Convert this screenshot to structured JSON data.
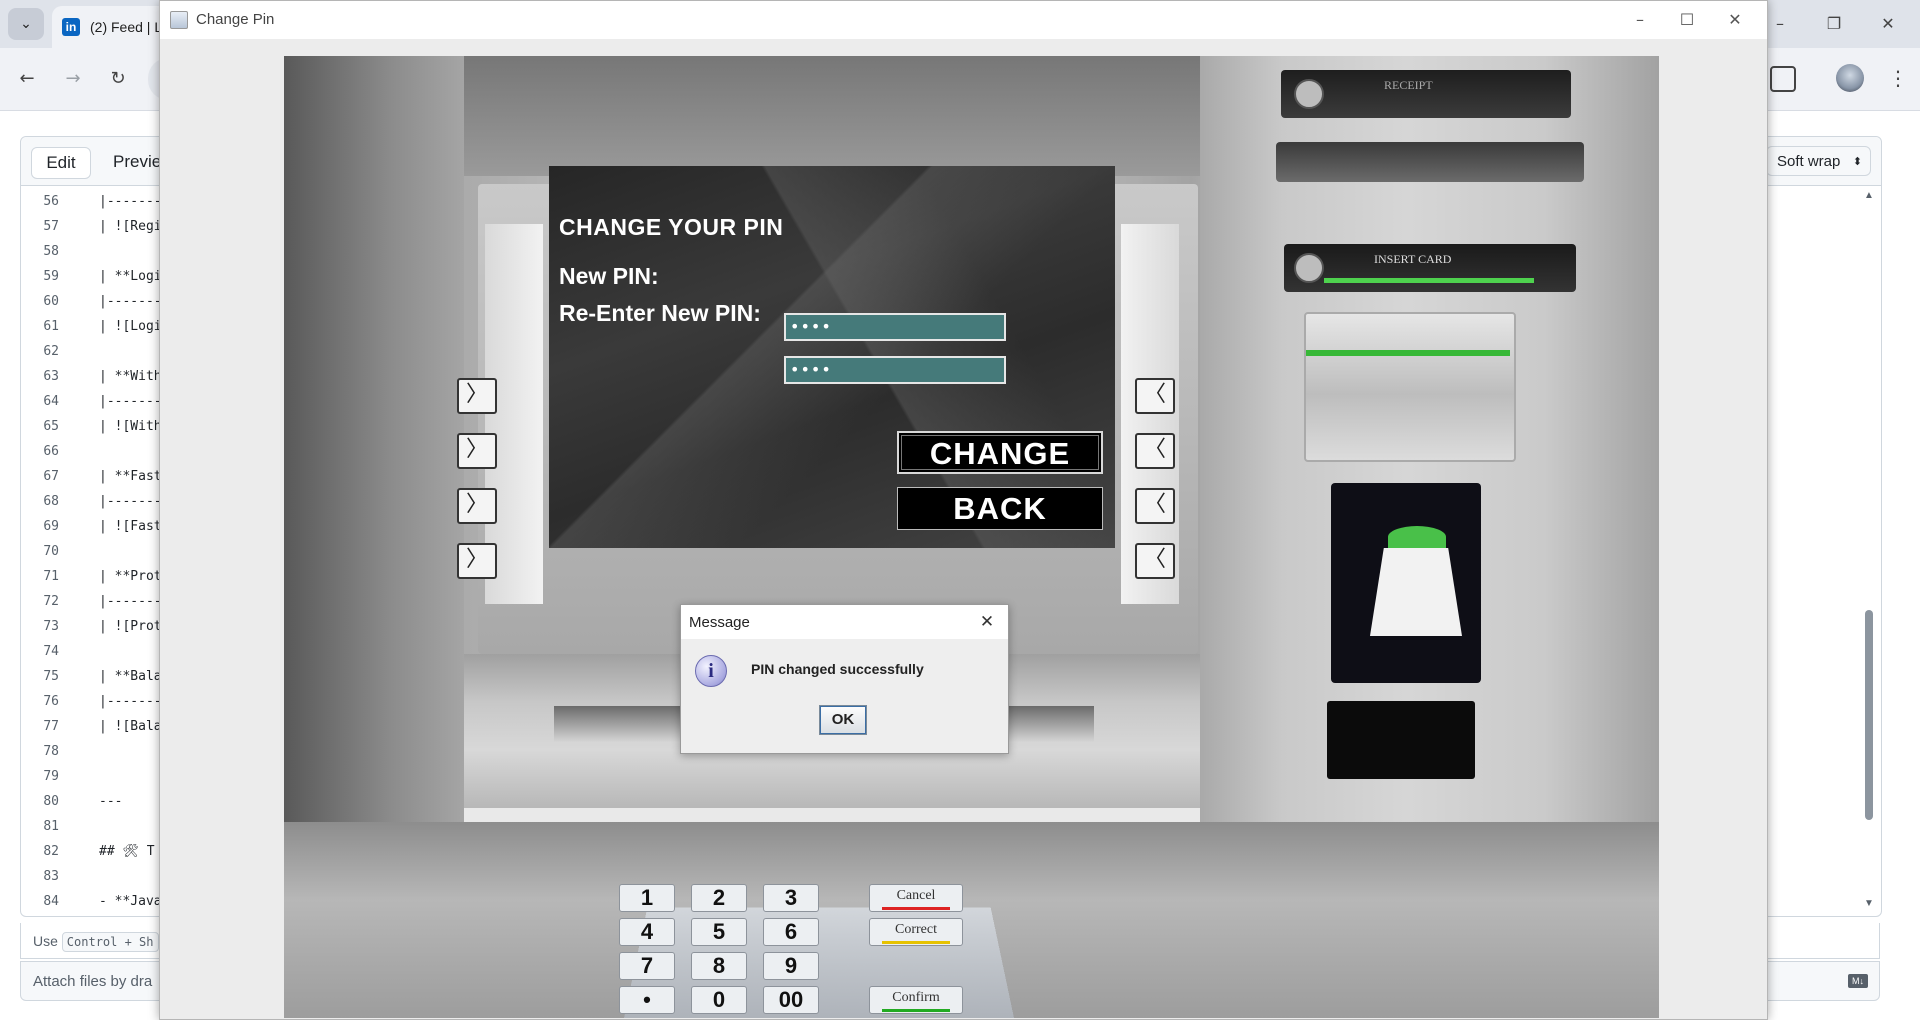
{
  "browser": {
    "tab_title": "(2) Feed | L",
    "tab_icon": "in"
  },
  "editor": {
    "tab_edit": "Edit",
    "tab_preview": "Previe",
    "soft_wrap": "Soft wrap",
    "lines": [
      {
        "n": "56",
        "t": "|-------"
      },
      {
        "n": "57",
        "t": "| ![Regi"
      },
      {
        "n": "58",
        "t": ""
      },
      {
        "n": "59",
        "t": "| **Logi"
      },
      {
        "n": "60",
        "t": "|-------"
      },
      {
        "n": "61",
        "t": "| ![Logi"
      },
      {
        "n": "62",
        "t": ""
      },
      {
        "n": "63",
        "t": "| **With"
      },
      {
        "n": "64",
        "t": "|-------"
      },
      {
        "n": "65",
        "t": "| ![With"
      },
      {
        "n": "66",
        "t": ""
      },
      {
        "n": "67",
        "t": "| **Fast"
      },
      {
        "n": "68",
        "t": "|-------"
      },
      {
        "n": "69",
        "t": "| ![Fast"
      },
      {
        "n": "70",
        "t": ""
      },
      {
        "n": "71",
        "t": "| **Prot"
      },
      {
        "n": "72",
        "t": "|-------"
      },
      {
        "n": "73",
        "t": "| ![Prot"
      },
      {
        "n": "74",
        "t": ""
      },
      {
        "n": "75",
        "t": "| **Bala"
      },
      {
        "n": "76",
        "t": "|-------"
      },
      {
        "n": "77",
        "t": "| ![Bala"
      },
      {
        "n": "78",
        "t": ""
      },
      {
        "n": "79",
        "t": ""
      },
      {
        "n": "80",
        "t": "---"
      },
      {
        "n": "81",
        "t": ""
      },
      {
        "n": "82",
        "t": "## 🛠 T"
      },
      {
        "n": "83",
        "t": ""
      },
      {
        "n": "84",
        "t": "- **Java"
      }
    ],
    "hint_prefix": "Use",
    "hint_kbd": "Control + Sh",
    "attach": "Attach files by dra"
  },
  "window": {
    "title": "Change Pin"
  },
  "atm": {
    "screen_title": "CHANGE YOUR PIN",
    "new_pin_label": "New PIN:",
    "reenter_label": "Re-Enter New PIN:",
    "new_pin_value": "••••",
    "reenter_value": "••••",
    "change_button": "CHANGE",
    "back_button": "BACK",
    "receipt_label": "RECEIPT",
    "card_label": "INSERT CARD",
    "keypad": {
      "keys": [
        "1",
        "2",
        "3",
        "4",
        "5",
        "6",
        "7",
        "8",
        "9",
        "•",
        "0",
        "00"
      ],
      "cancel": "Cancel",
      "correct": "Correct",
      "confirm": "Confirm"
    }
  },
  "dialog": {
    "title": "Message",
    "message": "PIN changed successfully",
    "ok": "OK"
  }
}
